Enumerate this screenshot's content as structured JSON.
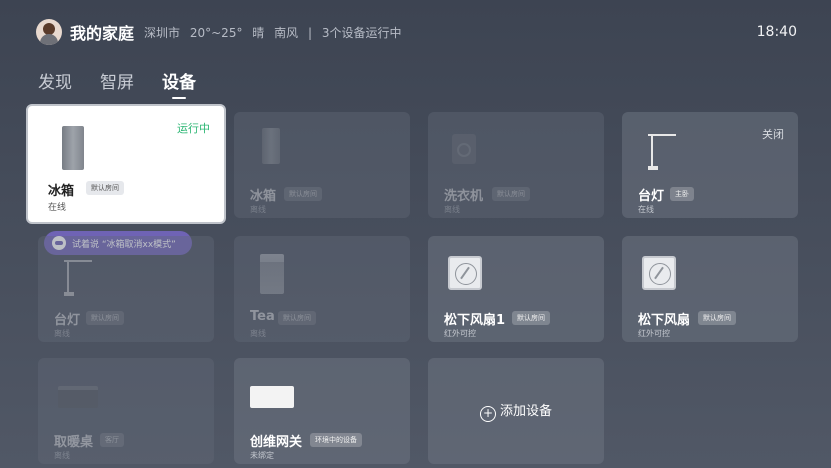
{
  "header": {
    "home_name": "我的家庭",
    "city": "深圳市",
    "temperature": "20°~25°",
    "weather": "晴",
    "wind": "南风",
    "separator": "|",
    "running_devices": "3个设备运行中",
    "time": "18:40"
  },
  "tabs": [
    {
      "label": "发现",
      "active": false
    },
    {
      "label": "智屏",
      "active": false
    },
    {
      "label": "设备",
      "active": true
    }
  ],
  "voice_hint": "试着说 “冰箱取消xx模式”",
  "devices": [
    {
      "name": "冰箱",
      "tag": "默认房间",
      "sub": "在线",
      "status": "运行中",
      "status_color": "#2bb673",
      "icon": "fridge-icon",
      "state": "focused"
    },
    {
      "name": "冰箱",
      "tag": "默认房间",
      "sub": "离线",
      "icon": "fridge-icon",
      "state": "offline"
    },
    {
      "name": "洗衣机",
      "tag": "默认房间",
      "sub": "离线",
      "icon": "washer-icon",
      "state": "offline"
    },
    {
      "name": "台灯",
      "tag": "主卧",
      "sub": "在线",
      "status": "关闭",
      "icon": "desk-lamp-icon",
      "state": "online"
    },
    {
      "name": "台灯",
      "tag": "默认房间",
      "sub": "离线",
      "icon": "desk-lamp-icon",
      "state": "offline"
    },
    {
      "name": "Tea",
      "tag": "默认房间",
      "sub": "离线",
      "icon": "water-bucket-icon",
      "state": "offline"
    },
    {
      "name": "松下风扇1",
      "tag": "默认房间",
      "sub": "红外可控",
      "icon": "fan-icon",
      "state": "online"
    },
    {
      "name": "松下风扇",
      "tag": "默认房间",
      "sub": "红外可控",
      "icon": "fan-icon",
      "state": "online"
    },
    {
      "name": "取暖桌",
      "tag": "客厅",
      "sub": "离线",
      "icon": "heater-table-icon",
      "state": "offline"
    },
    {
      "name": "创维网关",
      "tag": "环境中的设备",
      "sub": "未绑定",
      "icon": "gateway-icon",
      "state": "online"
    }
  ],
  "add_device_label": "添加设备",
  "colors": {
    "accent_running": "#2bb673",
    "hint_bg": "#6f63b5"
  }
}
